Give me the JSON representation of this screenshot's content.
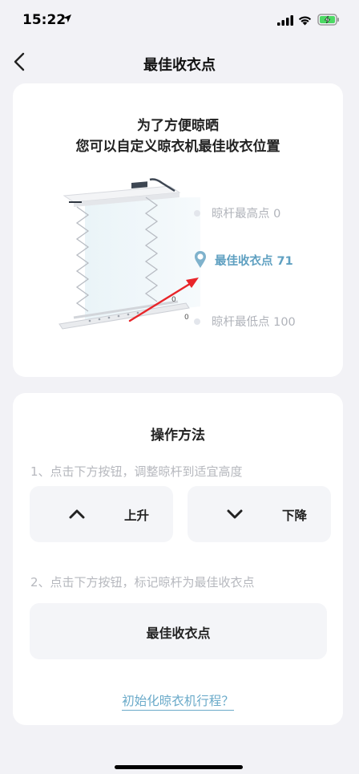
{
  "status_bar": {
    "time": "15:22"
  },
  "nav": {
    "title": "最佳收衣点"
  },
  "intro": {
    "line1": "为了方便晾晒",
    "line2": "您可以自定义晾衣机最佳收衣位置"
  },
  "levels": {
    "top": "晾杆最高点 0",
    "best": "最佳收衣点 71",
    "bottom": "晾杆最低点 100"
  },
  "method": {
    "title": "操作方法",
    "step1": "1、点击下方按钮，调整晾杆到适宜高度",
    "up_label": "上升",
    "down_label": "下降",
    "step2": "2、点击下方按钮，标记晾杆为最佳收衣点",
    "best_label": "最佳收衣点",
    "init_link": "初始化晾衣机行程？"
  },
  "colors": {
    "accent": "#5fa0c1",
    "arrow": "#e8252a",
    "background": "#f2f2f6",
    "card": "#ffffff",
    "button": "#f4f5f8"
  },
  "icons": {
    "back": "chevron-left-icon",
    "up": "chevron-up-icon",
    "down": "chevron-down-icon",
    "location": "location-arrow-icon",
    "signal": "cellular-signal-icon",
    "wifi": "wifi-icon",
    "battery": "battery-charging-icon",
    "pin": "location-pin-icon"
  }
}
